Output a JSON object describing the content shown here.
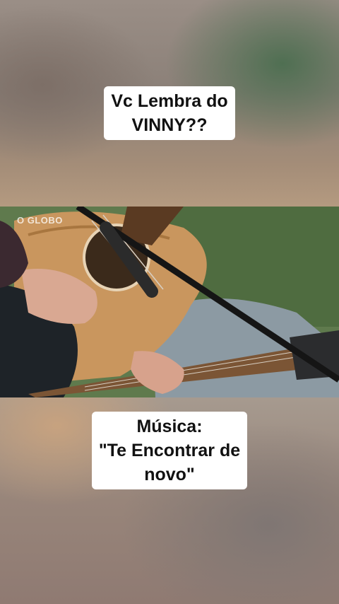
{
  "caption_top": {
    "line1": "Vc Lembra do",
    "line2": "VINNY??"
  },
  "video": {
    "watermark": "O GLOBO",
    "description_icon": "guitar-performance"
  },
  "caption_bottom": {
    "line1": "Música:",
    "line2": "\"Te Encontrar de",
    "line3": "novo\""
  },
  "colors": {
    "caption_bg": "#ffffff",
    "caption_text": "#111111",
    "guitar_wood": "#c9965e",
    "grass": "#5f7a4d"
  }
}
